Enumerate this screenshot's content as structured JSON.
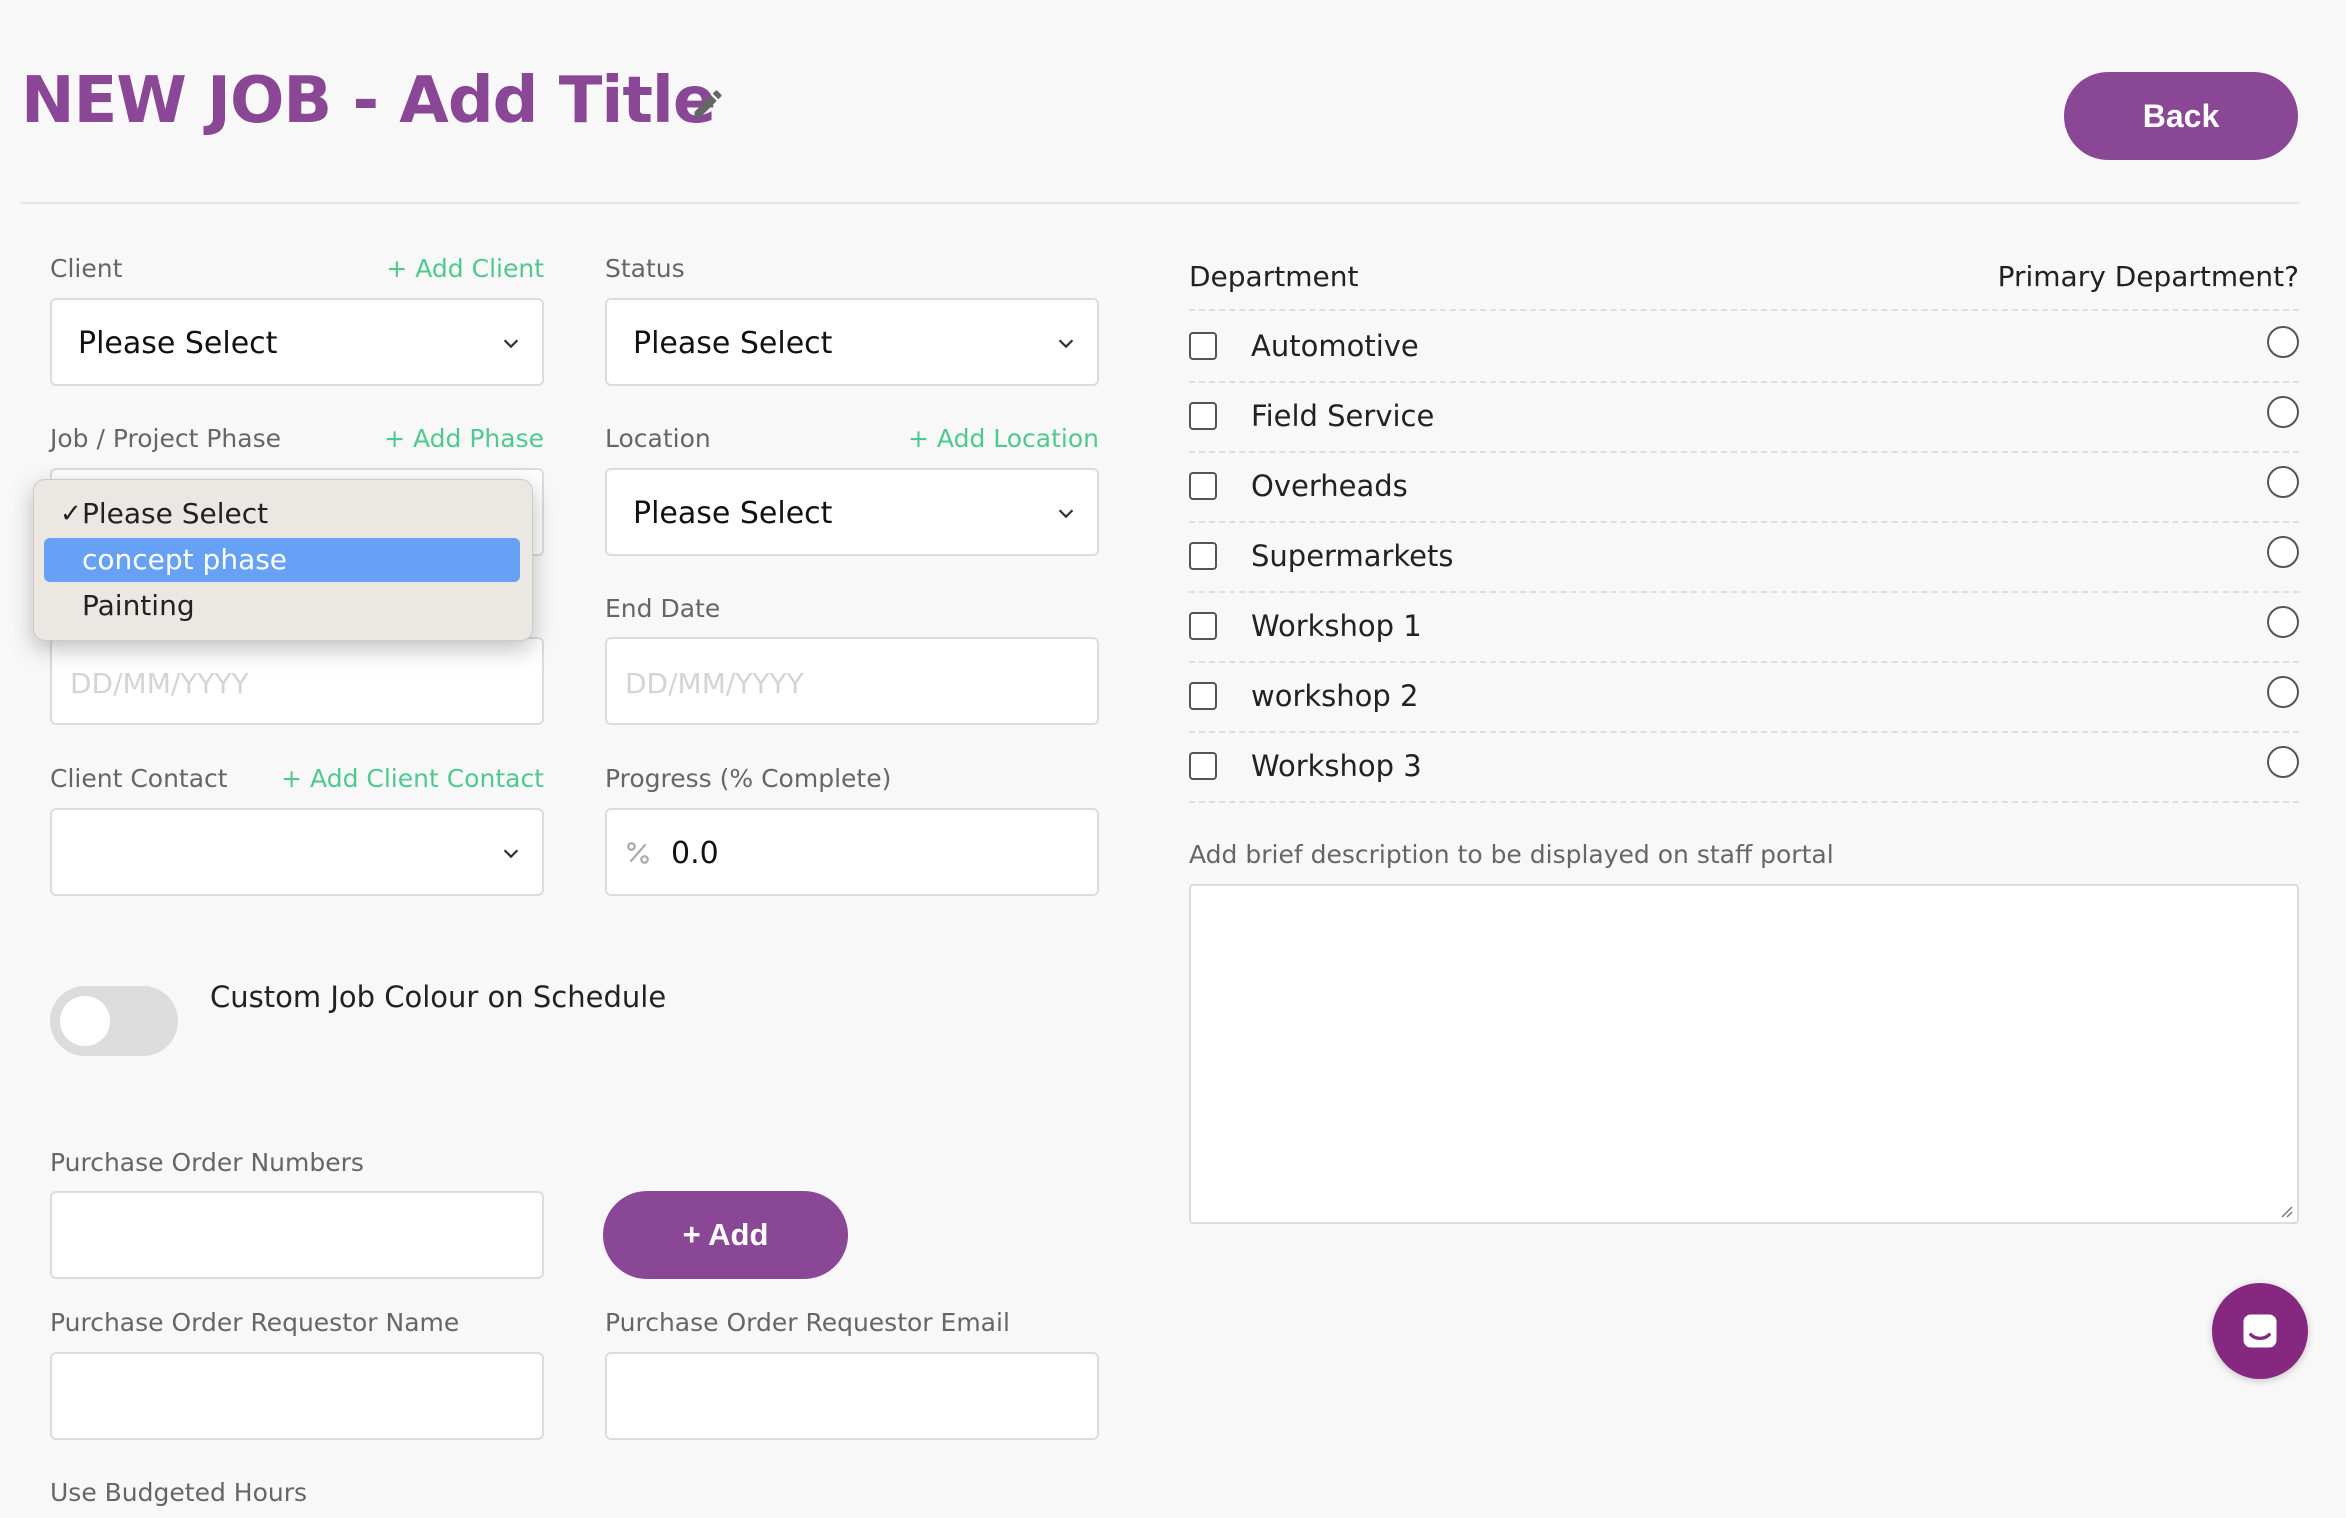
{
  "header": {
    "title": "NEW JOB - Add Title",
    "back_label": "Back"
  },
  "form": {
    "client_label": "Client",
    "add_client": "+ Add Client",
    "client_value": "Please Select",
    "status_label": "Status",
    "status_value": "Please Select",
    "phase_label": "Job / Project Phase",
    "add_phase": "+ Add Phase",
    "phase_options": [
      "Please Select",
      "concept phase",
      "Painting"
    ],
    "location_label": "Location",
    "add_location": "+ Add Location",
    "location_value": "Please Select",
    "end_date_label": "End Date",
    "date_placeholder": "DD/MM/YYYY",
    "client_contact_label": "Client Contact",
    "add_client_contact": "+ Add Client Contact",
    "progress_label": "Progress (% Complete)",
    "progress_value": "0.0",
    "custom_colour_label": "Custom Job Colour on Schedule",
    "po_numbers_label": "Purchase Order Numbers",
    "add_button": "+ Add",
    "po_requestor_name_label": "Purchase Order Requestor Name",
    "po_requestor_email_label": "Purchase Order Requestor Email",
    "budgeted_hours_label": "Use Budgeted Hours"
  },
  "departments": {
    "header": "Department",
    "primary_header": "Primary Department?",
    "items": [
      "Automotive",
      "Field Service",
      "Overheads",
      "Supermarkets",
      "Workshop 1",
      "workshop 2",
      "Workshop 3"
    ]
  },
  "description": {
    "label": "Add brief description to be displayed on staff portal"
  },
  "colors": {
    "brand": "#8a4796",
    "link": "#4fc98e",
    "highlight": "#67a1f5"
  }
}
